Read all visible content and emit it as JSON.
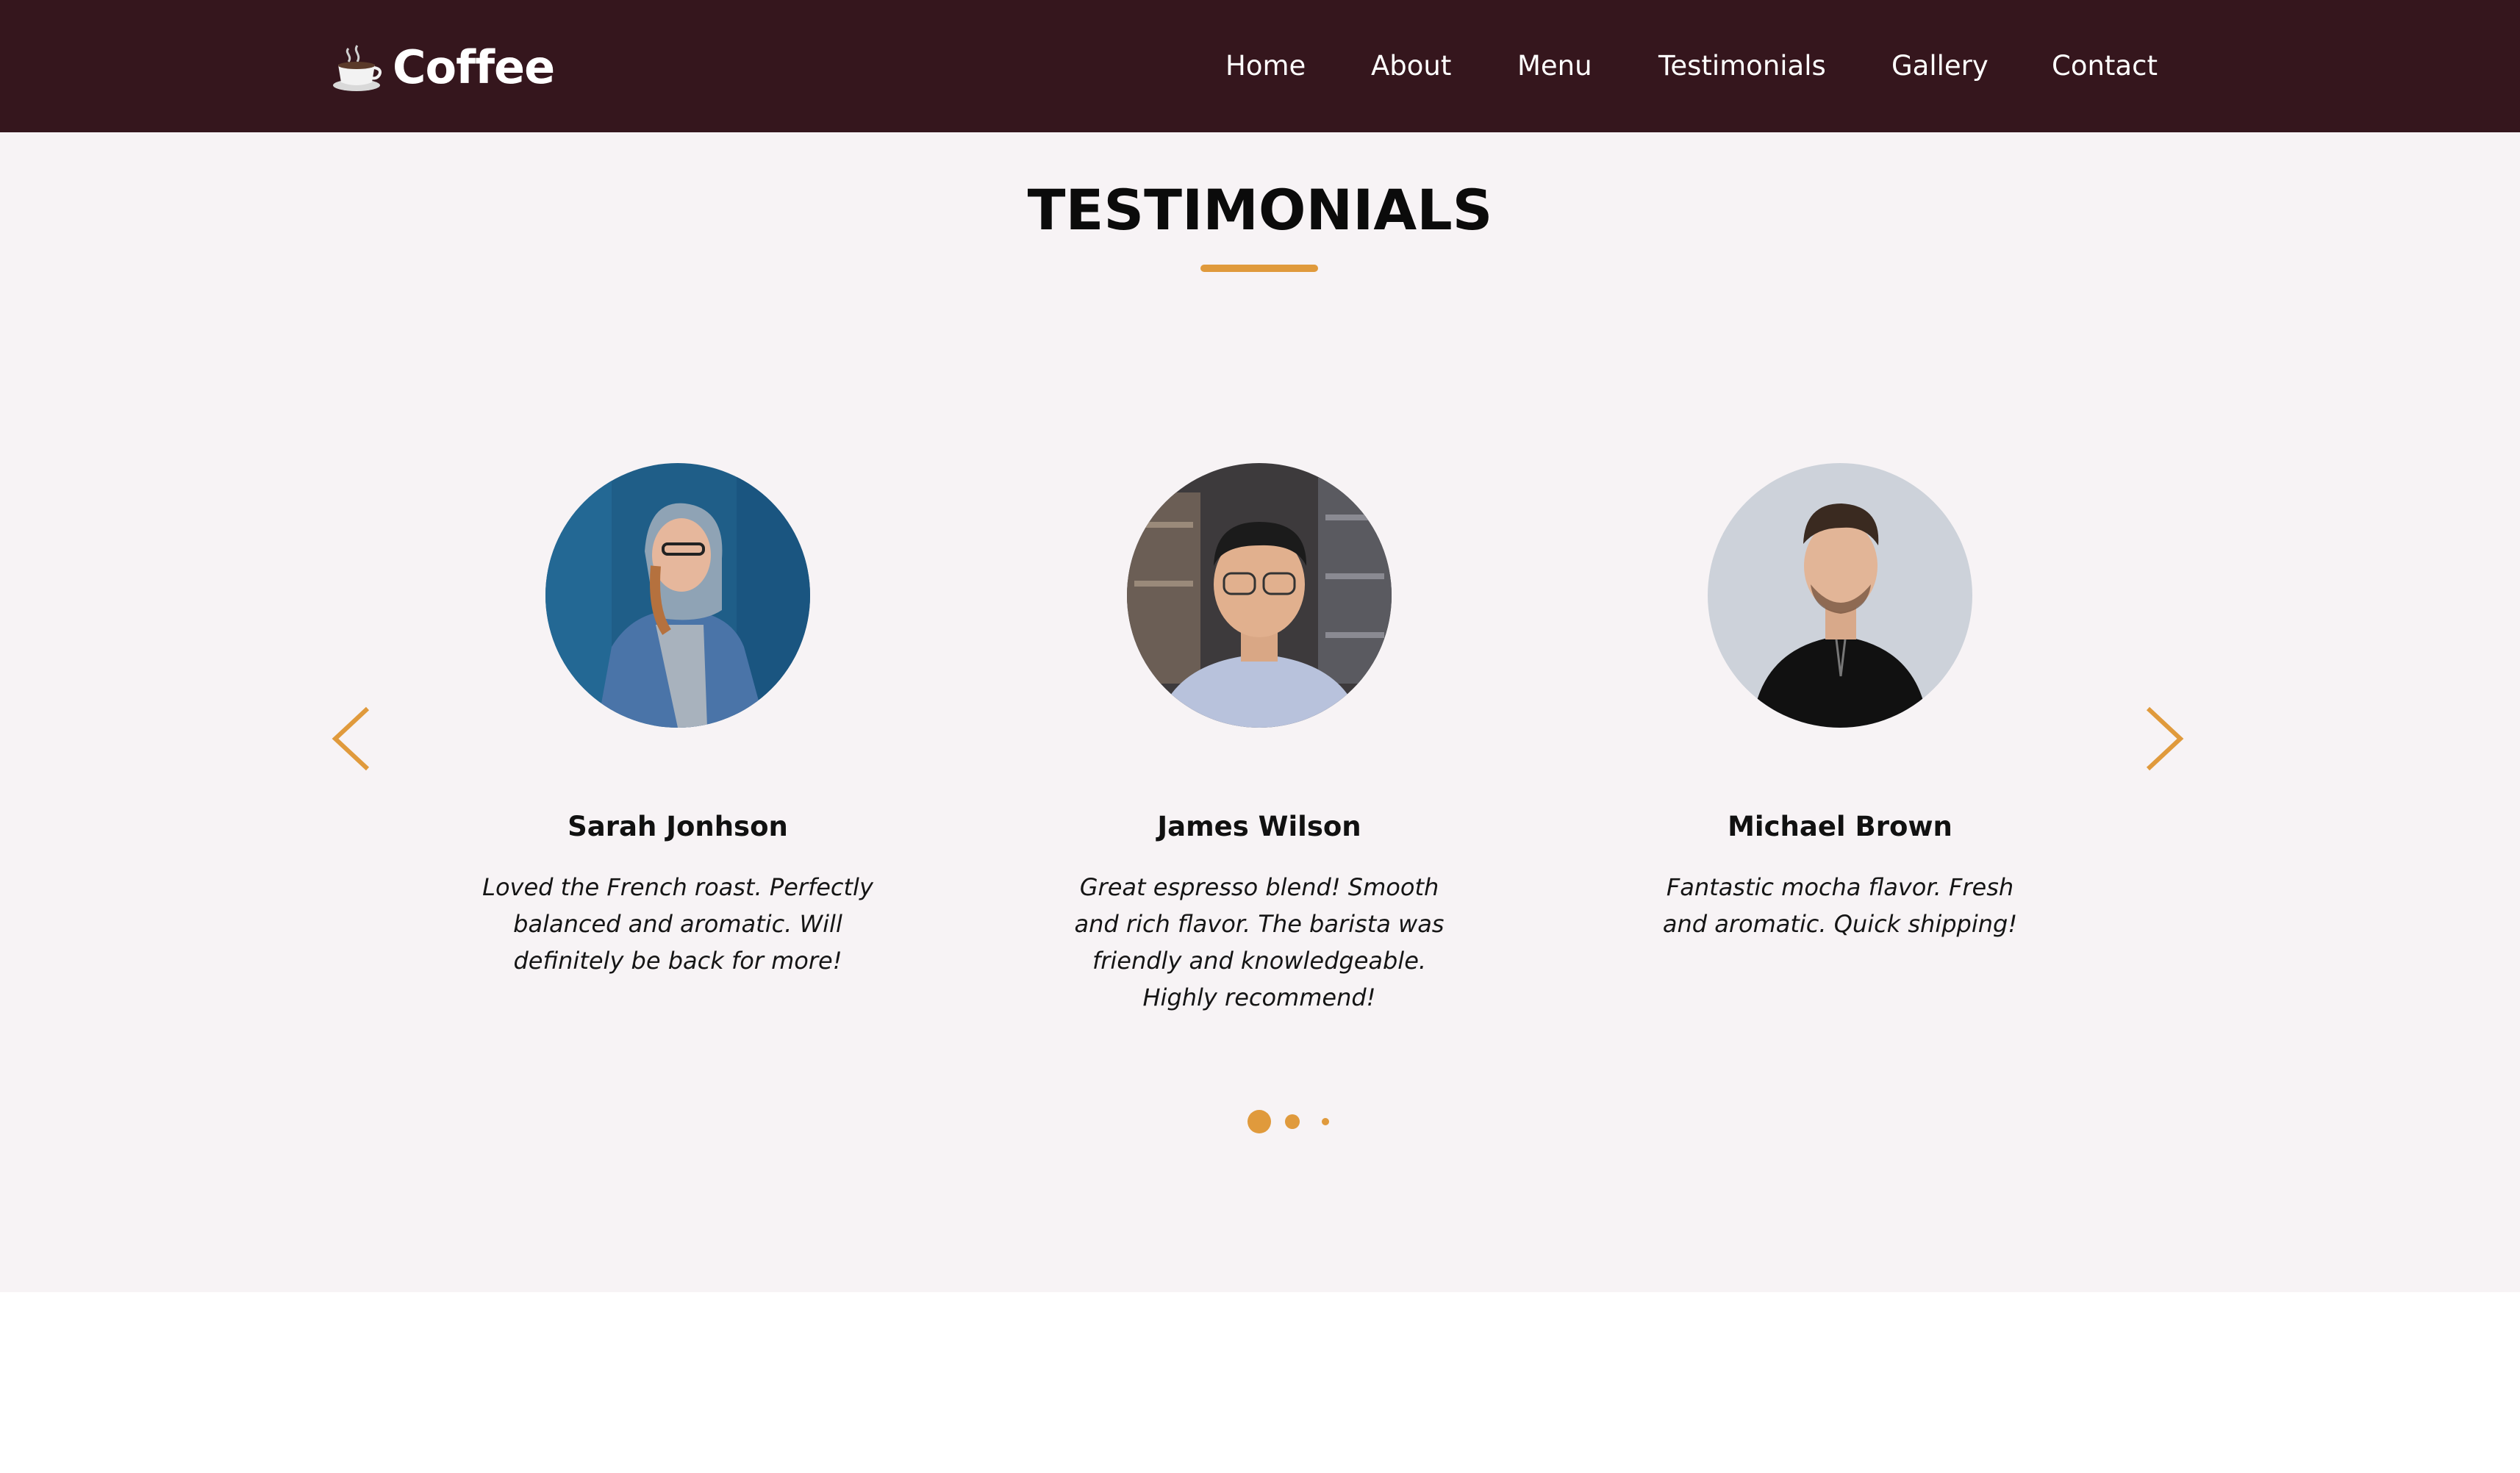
{
  "brand": {
    "icon": "coffee-cup-icon",
    "name": "Coffee"
  },
  "nav": {
    "items": [
      {
        "label": "Home"
      },
      {
        "label": "About"
      },
      {
        "label": "Menu"
      },
      {
        "label": "Testimonials"
      },
      {
        "label": "Gallery"
      },
      {
        "label": "Contact"
      }
    ]
  },
  "testimonials": {
    "title": "TESTIMONIALS",
    "cards": [
      {
        "name": "Sarah Jonhson",
        "text": "Loved the French roast. Perfectly balanced and aromatic. Will definitely be back for more!"
      },
      {
        "name": "James Wilson",
        "text": "Great espresso blend! Smooth and rich flavor. The barista was friendly and knowledgeable. Highly recommend!"
      },
      {
        "name": "Michael Brown",
        "text": "Fantastic mocha flavor. Fresh and aromatic. Quick shipping!"
      }
    ],
    "prev_icon": "chevron-left-icon",
    "next_icon": "chevron-right-icon",
    "pagination": {
      "count": 3,
      "active": 1
    }
  },
  "colors": {
    "navbar": "#35161d",
    "accent": "#e09a3c",
    "section_bg": "#f7f3f5"
  }
}
